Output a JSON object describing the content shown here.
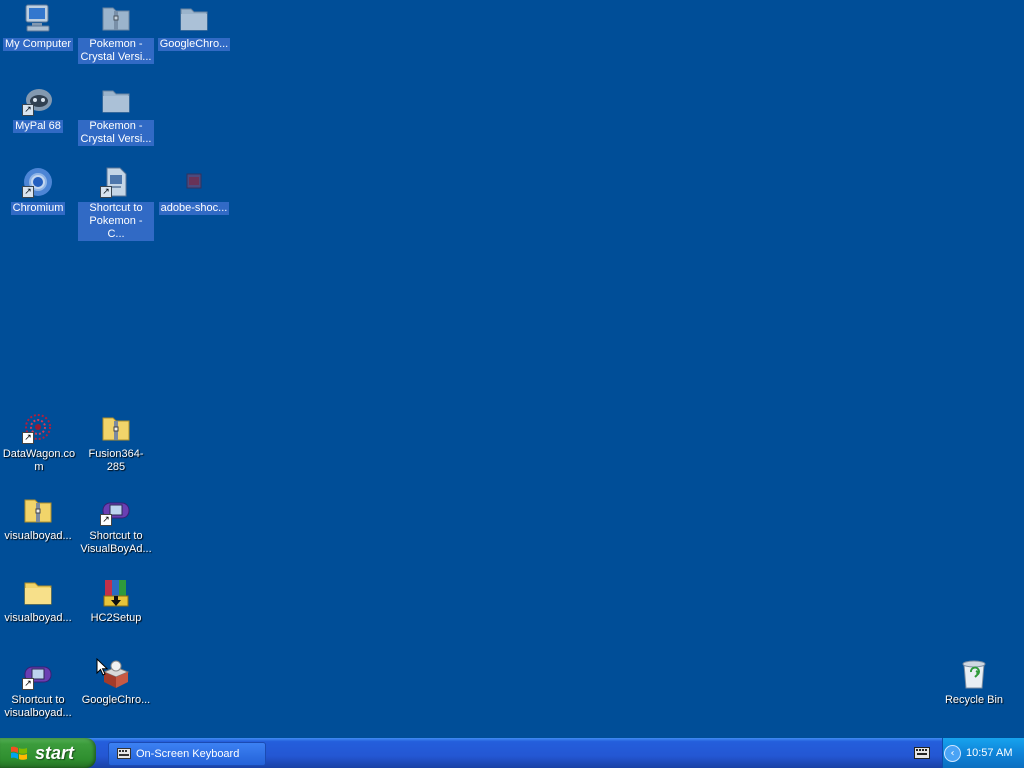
{
  "desktop": {
    "icons": [
      {
        "label": "My Computer"
      },
      {
        "label": "Pokemon - Crystal Versi..."
      },
      {
        "label": "GoogleChro..."
      },
      {
        "label": "MyPal 68"
      },
      {
        "label": "Pokemon - Crystal Versi..."
      },
      {
        "label": "Chromium"
      },
      {
        "label": "Shortcut to Pokemon - C..."
      },
      {
        "label": "adobe-shoc..."
      },
      {
        "label": "DataWagon.com"
      },
      {
        "label": "Fusion364-285"
      },
      {
        "label": "visualboyad..."
      },
      {
        "label": "Shortcut to VisualBoyAd..."
      },
      {
        "label": "visualboyad..."
      },
      {
        "label": "HC2Setup"
      },
      {
        "label": "Shortcut to visualboyad..."
      },
      {
        "label": "GoogleChro..."
      },
      {
        "label": "Recycle Bin"
      }
    ]
  },
  "taskbar": {
    "start_label": "start",
    "tasks": [
      {
        "label": "On-Screen Keyboard"
      }
    ],
    "clock": "10:57 AM"
  },
  "colors": {
    "desktop_bg": "#004e98",
    "selection": "#316ac5",
    "taskbar_blue": "#245edc",
    "start_green": "#3c9c3c",
    "tray_blue": "#0f84d9"
  },
  "icons_semantic": [
    "computer-icon",
    "zip-folder-icon",
    "folder-icon",
    "mypal-icon",
    "chromium-icon",
    "shortcut-file-icon",
    "adobe-file-icon",
    "datawagon-icon",
    "setup-box-icon",
    "winrar-icon",
    "gba-icon",
    "recycle-bin-icon",
    "keyboard-icon",
    "windows-flag-icon",
    "chevron-left-icon"
  ]
}
